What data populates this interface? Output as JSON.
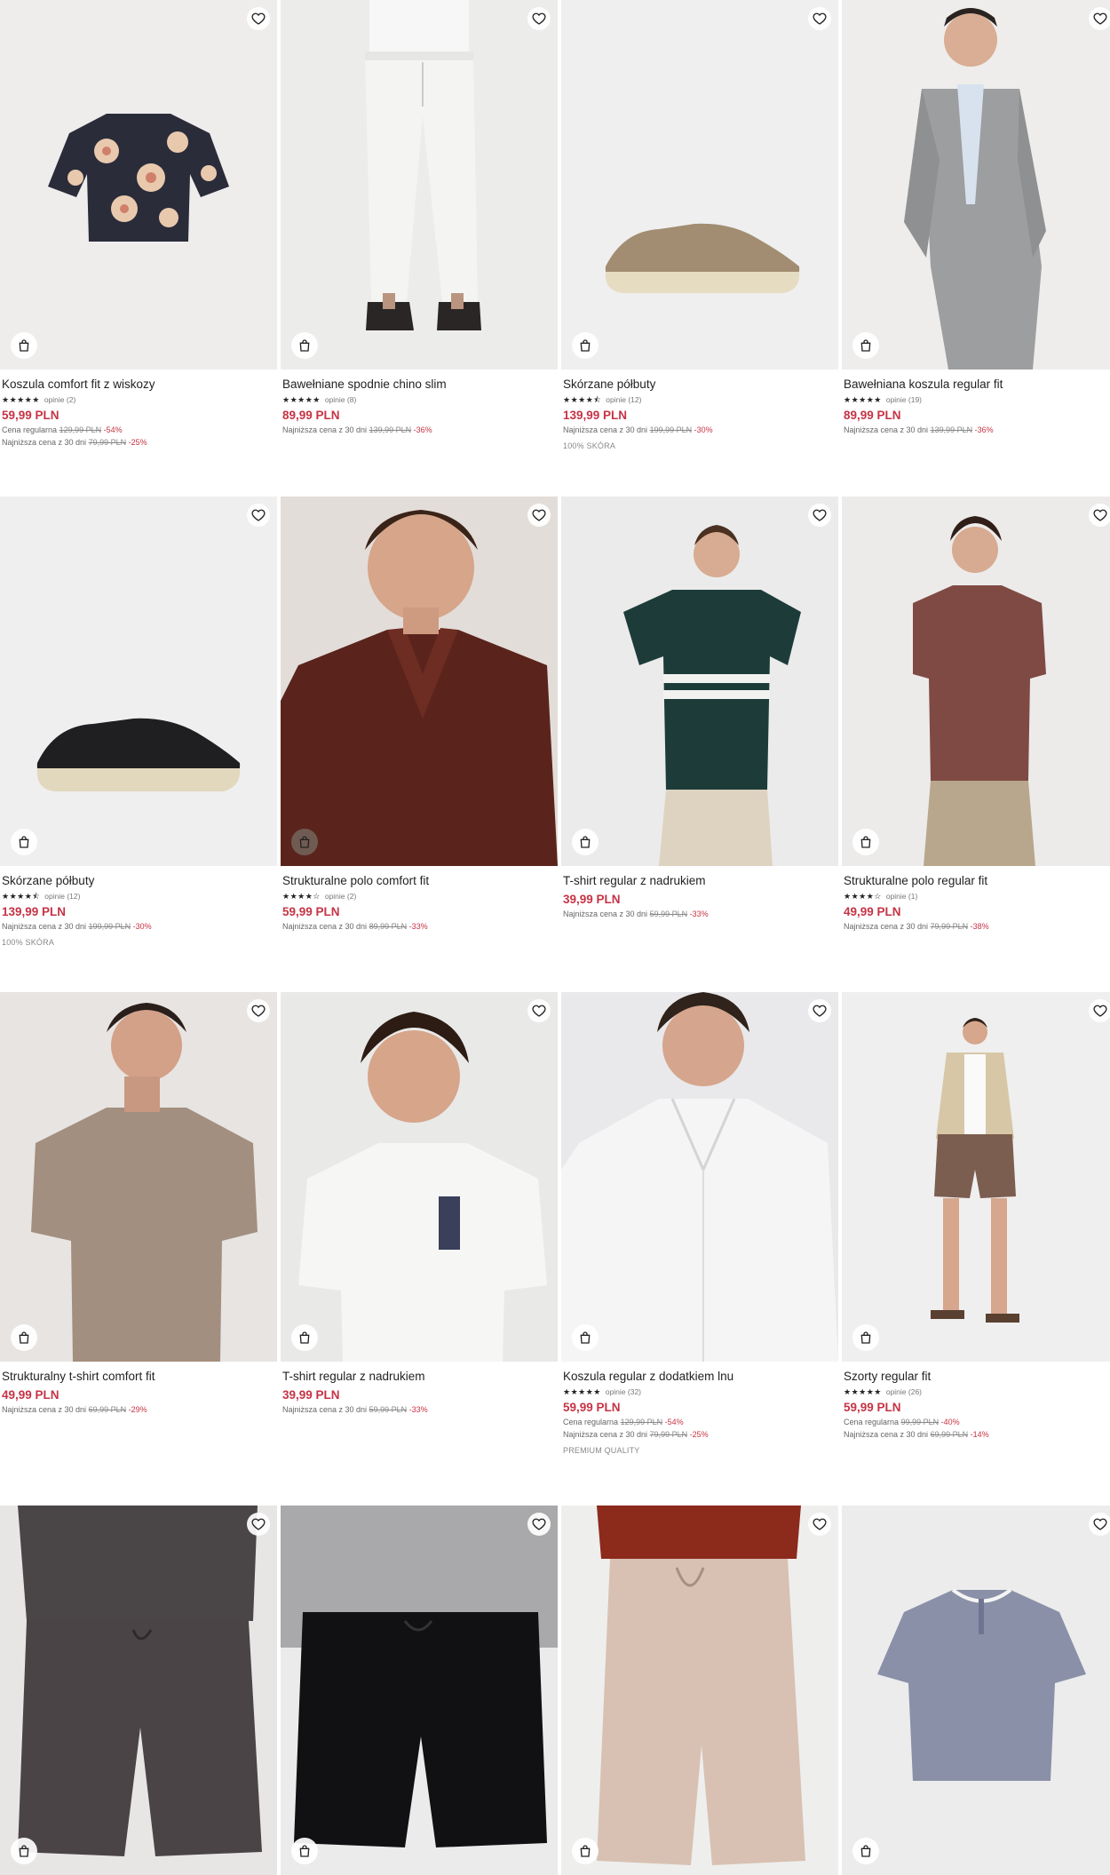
{
  "icons": {
    "wishlist": "heart-icon",
    "cart": "shopping-bag-icon"
  },
  "colors": {
    "price": "#c63345",
    "discount": "#c63345",
    "text": "#222222",
    "muted": "#666666"
  },
  "products": [
    {
      "name": "Koszula comfort fit z wiskozy",
      "stars": "★★★★★",
      "reviews": "opinie (2)",
      "price": "59,99 PLN",
      "lines": [
        {
          "label": "Cena regularna",
          "old": "129,99 PLN",
          "discount": "-54%"
        },
        {
          "label": "Najniższa cena z 30 dni",
          "old": "79,99 PLN",
          "discount": "-25%"
        }
      ],
      "tag": ""
    },
    {
      "name": "Bawełniane spodnie chino slim",
      "stars": "★★★★★",
      "reviews": "opinie (8)",
      "price": "89,99 PLN",
      "lines": [
        {
          "label": "Najniższa cena z 30 dni",
          "old": "139,99 PLN",
          "discount": "-36%"
        }
      ],
      "tag": ""
    },
    {
      "name": "Skórzane półbuty",
      "stars": "★★★★⯪",
      "reviews": "opinie (12)",
      "price": "139,99 PLN",
      "lines": [
        {
          "label": "Najniższa cena z 30 dni",
          "old": "199,99 PLN",
          "discount": "-30%"
        }
      ],
      "tag": "100% SKÓRA"
    },
    {
      "name": "Bawełniana koszula regular fit",
      "stars": "★★★★★",
      "reviews": "opinie (19)",
      "price": "89,99 PLN",
      "lines": [
        {
          "label": "Najniższa cena z 30 dni",
          "old": "139,99 PLN",
          "discount": "-36%"
        }
      ],
      "tag": ""
    },
    {
      "name": "Skórzane półbuty",
      "stars": "★★★★⯪",
      "reviews": "opinie (12)",
      "price": "139,99 PLN",
      "lines": [
        {
          "label": "Najniższa cena z 30 dni",
          "old": "199,99 PLN",
          "discount": "-30%"
        }
      ],
      "tag": "100% SKÓRA"
    },
    {
      "name": "Strukturalne polo comfort fit",
      "stars": "★★★★☆",
      "reviews": "opinie (2)",
      "price": "59,99 PLN",
      "lines": [
        {
          "label": "Najniższa cena z 30 dni",
          "old": "89,99 PLN",
          "discount": "-33%"
        }
      ],
      "tag": ""
    },
    {
      "name": "T-shirt regular z nadrukiem",
      "stars": "",
      "reviews": "",
      "price": "39,99 PLN",
      "lines": [
        {
          "label": "Najniższa cena z 30 dni",
          "old": "59,99 PLN",
          "discount": "-33%"
        }
      ],
      "tag": ""
    },
    {
      "name": "Strukturalne polo regular fit",
      "stars": "★★★★☆",
      "reviews": "opinie (1)",
      "price": "49,99 PLN",
      "lines": [
        {
          "label": "Najniższa cena z 30 dni",
          "old": "79,99 PLN",
          "discount": "-38%"
        }
      ],
      "tag": ""
    },
    {
      "name": "Strukturalny t-shirt comfort fit",
      "stars": "",
      "reviews": "",
      "price": "49,99 PLN",
      "lines": [
        {
          "label": "Najniższa cena z 30 dni",
          "old": "69,99 PLN",
          "discount": "-29%"
        }
      ],
      "tag": ""
    },
    {
      "name": "T-shirt regular z nadrukiem",
      "stars": "",
      "reviews": "",
      "price": "39,99 PLN",
      "lines": [
        {
          "label": "Najniższa cena z 30 dni",
          "old": "59,99 PLN",
          "discount": "-33%"
        }
      ],
      "tag": ""
    },
    {
      "name": "Koszula regular z dodatkiem lnu",
      "stars": "★★★★★",
      "reviews": "opinie (32)",
      "price": "59,99 PLN",
      "lines": [
        {
          "label": "Cena regularna",
          "old": "129,99 PLN",
          "discount": "-54%"
        },
        {
          "label": "Najniższa cena z 30 dni",
          "old": "79,99 PLN",
          "discount": "-25%"
        }
      ],
      "tag": "PREMIUM QUALITY"
    },
    {
      "name": "Szorty regular fit",
      "stars": "★★★★★",
      "reviews": "opinie (26)",
      "price": "59,99 PLN",
      "lines": [
        {
          "label": "Cena regularna",
          "old": "99,99 PLN",
          "discount": "-40%"
        },
        {
          "label": "Najniższa cena z 30 dni",
          "old": "69,99 PLN",
          "discount": "-14%"
        }
      ],
      "tag": ""
    },
    {
      "name": "",
      "stars": "",
      "reviews": "",
      "price": "",
      "lines": [],
      "tag": ""
    },
    {
      "name": "",
      "stars": "",
      "reviews": "",
      "price": "",
      "lines": [],
      "tag": ""
    },
    {
      "name": "",
      "stars": "",
      "reviews": "",
      "price": "",
      "lines": [],
      "tag": ""
    },
    {
      "name": "",
      "stars": "",
      "reviews": "",
      "price": "",
      "lines": [],
      "tag": ""
    }
  ]
}
